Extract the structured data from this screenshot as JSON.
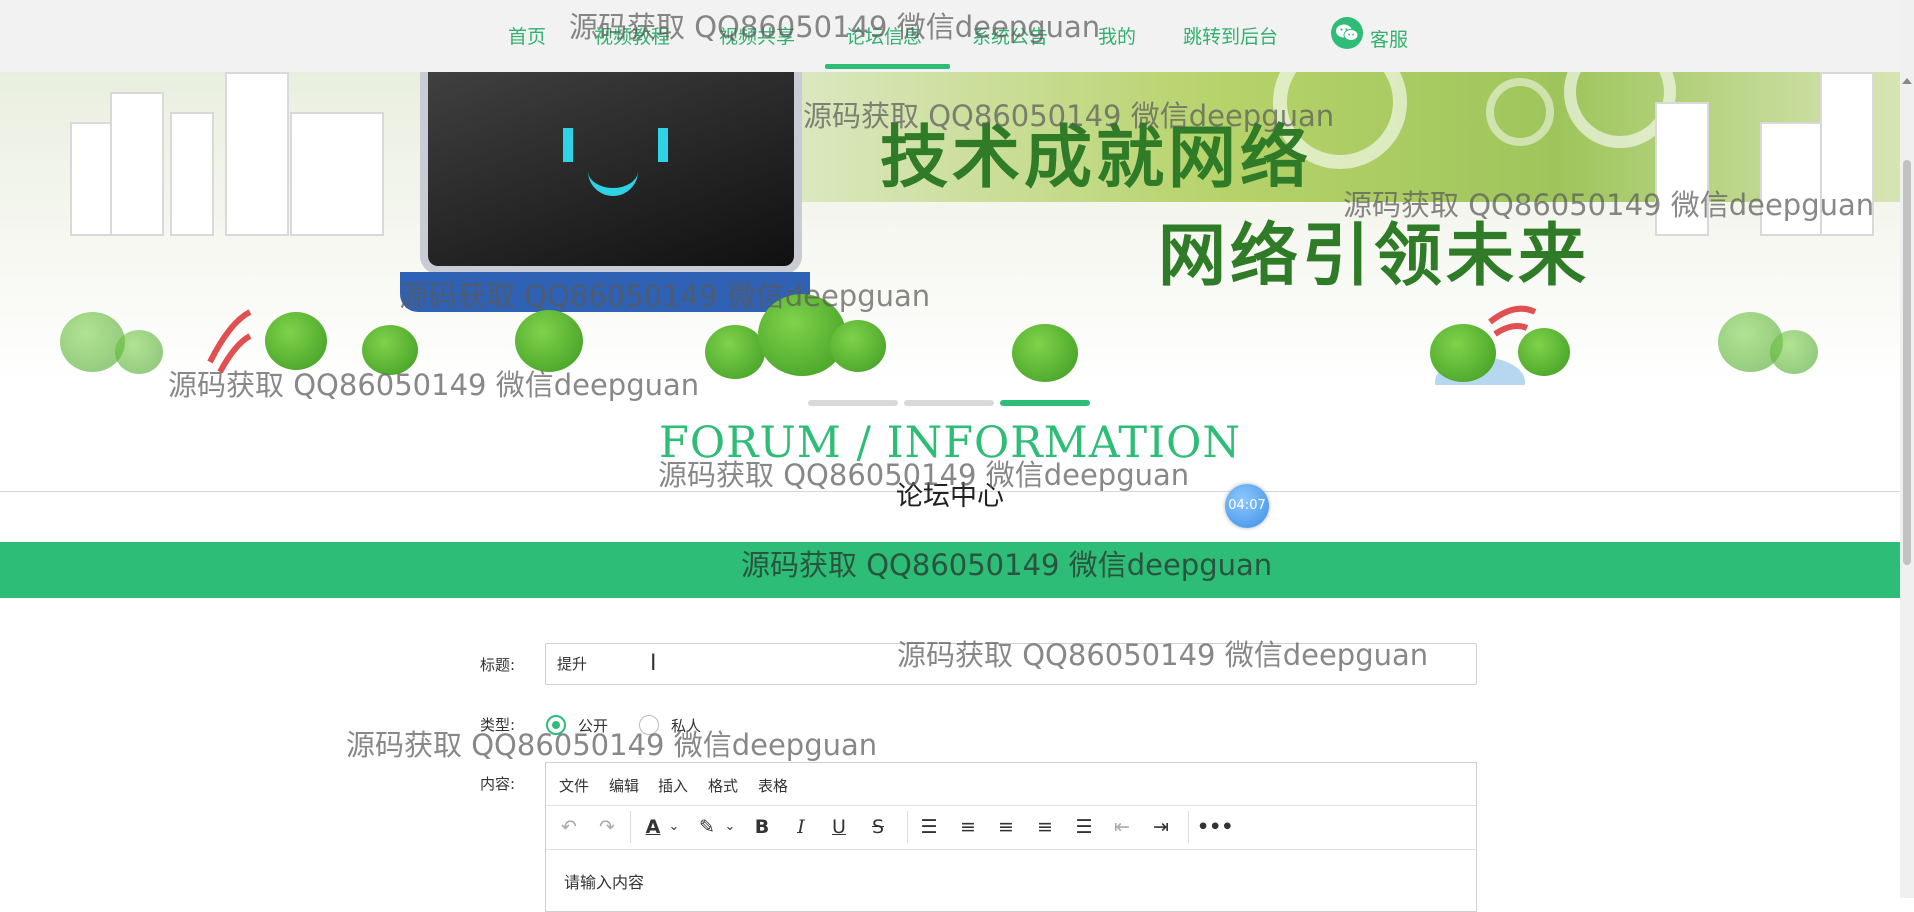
{
  "nav": {
    "items": [
      "首页",
      "视频教程",
      "视频共享",
      "论坛信息",
      "系统公告",
      "我的",
      "跳转到后台"
    ],
    "service_label": "客服",
    "active_index": 3
  },
  "banner": {
    "line1": "技术成就网络",
    "line2": "网络引领未来"
  },
  "section": {
    "title": "FORUM / INFORMATION",
    "subtitle": "论坛中心"
  },
  "timer": "04:07",
  "form": {
    "title_label": "标题:",
    "title_value": "提升",
    "type_label": "类型:",
    "type_options": [
      "公开",
      "私人"
    ],
    "type_selected": "公开",
    "content_label": "内容:",
    "editor_menu": [
      "文件",
      "编辑",
      "插入",
      "格式",
      "表格"
    ],
    "editor_placeholder": "请输入内容"
  },
  "watermark": "源码获取 QQ86050149 微信deepguan",
  "colors": {
    "accent": "#2ebd77",
    "nav_bg": "#f2f2f2"
  },
  "icons": {
    "service": "wechat-icon",
    "toolbar": [
      "undo-icon",
      "redo-icon",
      "font-color-icon",
      "highlight-icon",
      "bold-icon",
      "italic-icon",
      "underline-icon",
      "strikethrough-icon",
      "line-height-icon",
      "align-left-icon",
      "align-center-icon",
      "align-right-icon",
      "justify-icon",
      "outdent-icon",
      "indent-icon",
      "more-icon"
    ]
  }
}
